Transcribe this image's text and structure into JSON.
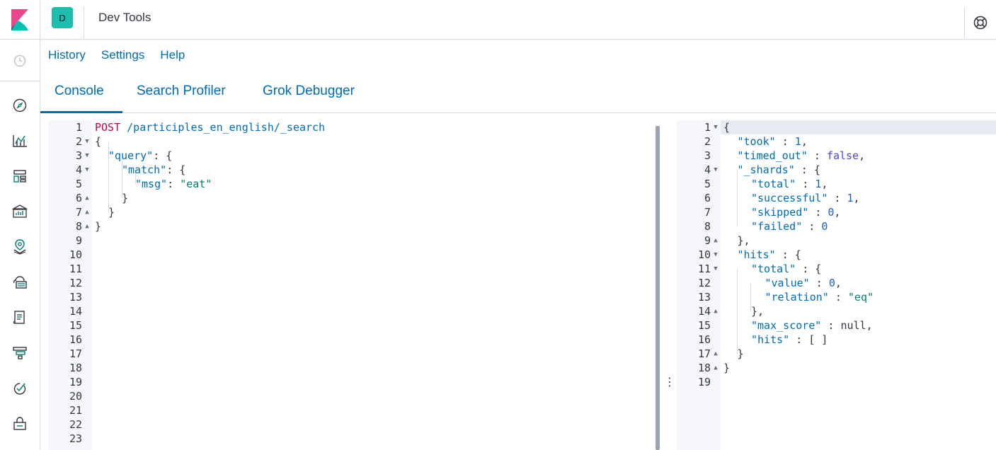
{
  "header": {
    "space_initial": "D",
    "app_title": "Dev Tools",
    "brand_colors": {
      "accent": "#006bb4",
      "space": "#1abfb0",
      "logo_pink": "#e8478b",
      "logo_teal": "#00bfb3"
    }
  },
  "sidenav": {
    "icons": [
      "recently-viewed-icon",
      "discover-icon",
      "visualize-icon",
      "dashboard-icon",
      "canvas-icon",
      "maps-icon",
      "machine-learning-icon",
      "logs-icon",
      "apm-icon",
      "uptime-icon",
      "dev-tools-icon"
    ]
  },
  "topmenu": {
    "history": "History",
    "settings": "Settings",
    "help": "Help"
  },
  "tabs": {
    "console": "Console",
    "search_profiler": "Search Profiler",
    "grok_debugger": "Grok Debugger"
  },
  "request": {
    "line_numbers": [
      "1",
      "2",
      "3",
      "4",
      "5",
      "6",
      "7",
      "8",
      "9",
      "10",
      "11",
      "12",
      "13",
      "14",
      "15",
      "16",
      "17",
      "18",
      "19",
      "20",
      "21",
      "22",
      "23"
    ],
    "method": "POST",
    "url": "/participles_en_english/_search",
    "lines": {
      "l2": "{",
      "l3_key": "\"query\"",
      "l3_rest": ": {",
      "l4_key": "\"match\"",
      "l4_rest": ": {",
      "l5_key": "\"msg\"",
      "l5_colon": ": ",
      "l5_val": "\"eat\"",
      "l6": "}",
      "l7": "}",
      "l8": "}"
    }
  },
  "response": {
    "line_numbers": [
      "1",
      "2",
      "3",
      "4",
      "5",
      "6",
      "7",
      "8",
      "9",
      "10",
      "11",
      "12",
      "13",
      "14",
      "15",
      "16",
      "17",
      "18",
      "19"
    ],
    "lines": [
      {
        "k": "",
        "p": "{",
        "v": "",
        "t": ""
      },
      {
        "k": "\"took\"",
        "p": " : ",
        "v": "1",
        "t": "num",
        "e": ","
      },
      {
        "k": "\"timed_out\"",
        "p": " : ",
        "v": "false",
        "t": "bool",
        "e": ","
      },
      {
        "k": "\"_shards\"",
        "p": " : {",
        "v": "",
        "t": ""
      },
      {
        "k": "\"total\"",
        "p": " : ",
        "v": "1",
        "t": "num",
        "e": ","
      },
      {
        "k": "\"successful\"",
        "p": " : ",
        "v": "1",
        "t": "num",
        "e": ","
      },
      {
        "k": "\"skipped\"",
        "p": " : ",
        "v": "0",
        "t": "num",
        "e": ","
      },
      {
        "k": "\"failed\"",
        "p": " : ",
        "v": "0",
        "t": "num",
        "e": ""
      },
      {
        "k": "",
        "p": "},",
        "v": "",
        "t": ""
      },
      {
        "k": "\"hits\"",
        "p": " : {",
        "v": "",
        "t": ""
      },
      {
        "k": "\"total\"",
        "p": " : {",
        "v": "",
        "t": ""
      },
      {
        "k": "\"value\"",
        "p": " : ",
        "v": "0",
        "t": "num",
        "e": ","
      },
      {
        "k": "\"relation\"",
        "p": " : ",
        "v": "\"eq\"",
        "t": "str",
        "e": ""
      },
      {
        "k": "",
        "p": "},",
        "v": "",
        "t": ""
      },
      {
        "k": "\"max_score\"",
        "p": " : ",
        "v": "null",
        "t": "plain",
        "e": ","
      },
      {
        "k": "\"hits\"",
        "p": " : [ ]",
        "v": "",
        "t": ""
      },
      {
        "k": "",
        "p": "}",
        "v": "",
        "t": ""
      },
      {
        "k": "",
        "p": "}",
        "v": "",
        "t": ""
      },
      {
        "k": "",
        "p": "",
        "v": "",
        "t": ""
      }
    ]
  }
}
